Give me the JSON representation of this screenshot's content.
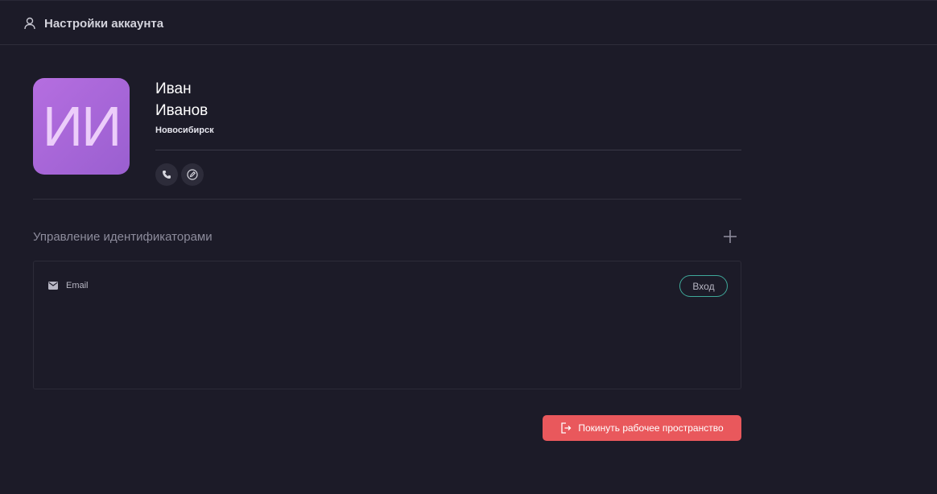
{
  "header": {
    "title": "Настройки аккаунта",
    "icon": "user-icon"
  },
  "profile": {
    "initials": "ИИ",
    "first_name": "Иван",
    "last_name": "Иванов",
    "city": "Новосибирск",
    "avatar_color": "#a866d8",
    "actions": [
      {
        "icon": "phone-icon"
      },
      {
        "icon": "edit-icon"
      }
    ]
  },
  "identifiers": {
    "title": "Управление идентификаторами",
    "add_icon": "plus-icon",
    "items": [
      {
        "icon": "mail-icon",
        "label": "Email",
        "badge": "Вход"
      }
    ]
  },
  "footer": {
    "leave_label": "Покинуть рабочее пространство",
    "leave_icon": "logout-icon",
    "leave_color": "#e9585c"
  }
}
